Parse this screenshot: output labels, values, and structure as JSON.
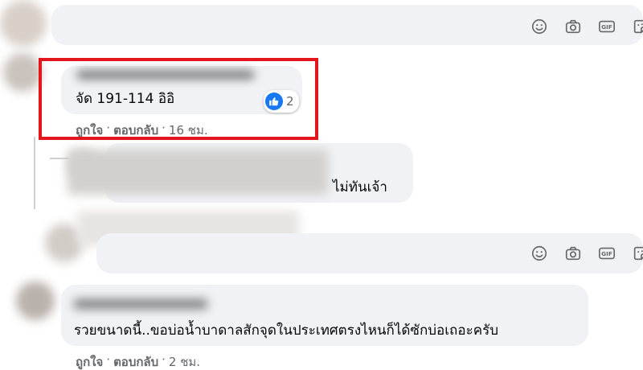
{
  "composer": {
    "icons": [
      "smiley-icon",
      "camera-icon",
      "gif-icon",
      "sticker-icon"
    ],
    "gif_label": "GIF"
  },
  "comments": [
    {
      "text": "จัด 191-114 อิอิ",
      "reaction_count": "2",
      "like_label": "ถูกใจ",
      "reply_label": "ตอบกลับ",
      "time": "16 ชม.",
      "separator": "·"
    },
    {
      "text": "ไม่ทันเจ้า"
    },
    {
      "text": "รวยขนาดนี้..ขอบ่อน้ำบาดาลสักจุดในประเทศตรงไหนก็ได้ซักบ่อเถอะครับ",
      "like_label": "ถูกใจ",
      "reply_label": "ตอบกลับ",
      "time": "2 ชม.",
      "separator": "·"
    }
  ],
  "colors": {
    "highlight": "#e3161d",
    "bubble": "#f0f2f5",
    "like_blue": "#1877f2",
    "meta_gray": "#65676b"
  }
}
